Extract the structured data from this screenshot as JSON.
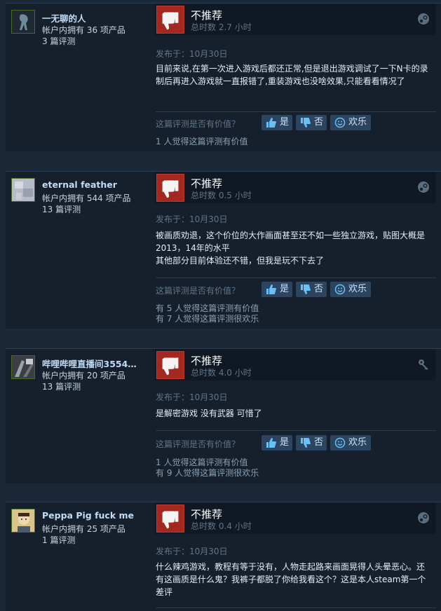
{
  "reviews": [
    {
      "username": "一无聊的人",
      "products_owned": "帐户内拥有 36 项产品",
      "review_count": "3 篇评测",
      "verdict": "不推荐",
      "hours": "总时数 2.7 小时",
      "posted": "发布于：10月30日",
      "content": "目前来说,在第一次进入游戏后都还正常,但是退出游戏调试了一下N卡的录制后再进入游戏就一直报错了,重装游戏也没啥效果,只能看看情况了",
      "helpful_question": "这篇评测是否有价值？",
      "btn_yes": "是",
      "btn_no": "否",
      "btn_funny": "欢乐",
      "stats": [
        "1 人觉得这篇评测有价值"
      ]
    },
    {
      "username": "eternal feather",
      "products_owned": "帐户内拥有 544 项产品",
      "review_count": "13 篇评测",
      "verdict": "不推荐",
      "hours": "总时数 0.5 小时",
      "posted": "发布于：10月30日",
      "content": "被画质劝退，这个价位的大作画面甚至还不如一些独立游戏，贴图大概是2013，14年的水平\n其他部分目前体验还不错，但我是玩不下去了",
      "helpful_question": "这篇评测是否有价值？",
      "btn_yes": "是",
      "btn_no": "否",
      "btn_funny": "欢乐",
      "stats": [
        "有 5 人觉得这篇评测有价值",
        "有 7 人觉得这篇评测很欢乐"
      ]
    },
    {
      "username": "哔哩哔哩直播间3554…",
      "products_owned": "帐户内拥有 20 项产品",
      "review_count": "13 篇评测",
      "verdict": "不推荐",
      "hours": "总时数 4.0 小时",
      "posted": "发布于：10月30日",
      "content": "是解密游戏 没有武器 可惜了",
      "helpful_question": "这篇评测是否有价值？",
      "btn_yes": "是",
      "btn_no": "否",
      "btn_funny": "欢乐",
      "stats": [
        "1 人觉得这篇评测有价值",
        "有 9 人觉得这篇评测很欢乐"
      ]
    },
    {
      "username": "Peppa Pig fuck me",
      "products_owned": "帐户内拥有 25 项产品",
      "review_count": "1 篇评测",
      "verdict": "不推荐",
      "hours": "总时数 0.4 小时",
      "posted": "发布于：10月30日",
      "content": "什么辣鸡游戏，教程有等于没有，人物走起路来画面晃得人头晕恶心。还有这画质是什么鬼？我裤子都脱了你给我看这个？这是本人steam第一个差评"
    }
  ],
  "colors": {
    "background": "#1b2838",
    "card": "#16202d",
    "thumb_down": "#a3281f",
    "name": "#c1dbf4"
  }
}
